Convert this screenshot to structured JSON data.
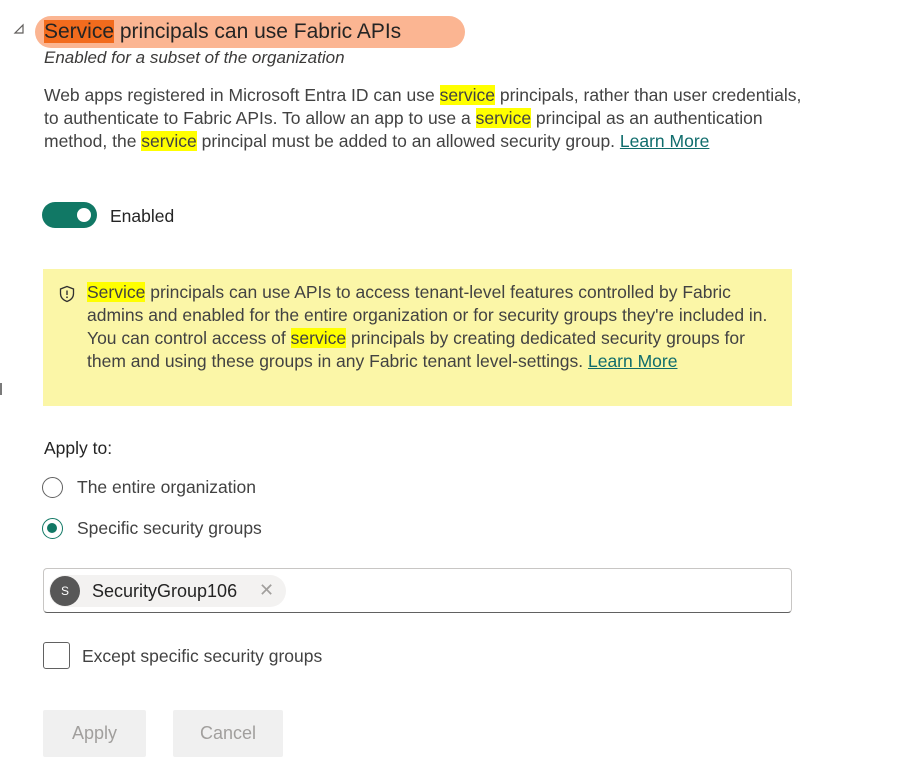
{
  "setting": {
    "title_highlight": "Service",
    "title_rest": " principals can use Fabric APIs",
    "subtitle": "Enabled for a subset of the organization",
    "description": {
      "p1": "Web apps registered in Microsoft Entra ID can use ",
      "hl1": "service",
      "p2": " principals, rather than user credentials, to authenticate to Fabric APIs. To allow an app to use a ",
      "hl2": "service",
      "p3": " principal as an authentication method, the ",
      "hl3": "service",
      "p4": " principal must be added to an allowed security group. ",
      "learn_more": "Learn More"
    }
  },
  "toggle": {
    "label": "Enabled",
    "state": "on"
  },
  "notice": {
    "hl1": "Service",
    "p1": " principals can use APIs to access tenant-level features controlled by Fabric admins and enabled for the entire organization or for security groups they're included in. You can control access of ",
    "hl2": "service",
    "p2": " principals by creating dedicated security groups for them and using these groups in any Fabric tenant level-settings. ",
    "learn_more": "Learn More"
  },
  "apply_to": {
    "label": "Apply to:",
    "options": [
      {
        "label": "The entire organization",
        "checked": false
      },
      {
        "label": "Specific security groups",
        "checked": true
      }
    ]
  },
  "security_groups": [
    {
      "initial": "S",
      "name": "SecurityGroup106"
    }
  ],
  "except_checkbox": {
    "label": "Except specific security groups",
    "checked": false
  },
  "buttons": {
    "apply": "Apply",
    "cancel": "Cancel"
  },
  "icons": {
    "collapse": "collapse-triangle-icon",
    "notice": "shield-info-icon",
    "remove": "dismiss-icon"
  },
  "colors": {
    "title_pill": "#fbb592",
    "title_highlight": "#f26b1d",
    "search_highlight": "#ffff00",
    "accent": "#117865",
    "notice_bg": "#fbf6a7",
    "link": "#0f6c6c"
  }
}
